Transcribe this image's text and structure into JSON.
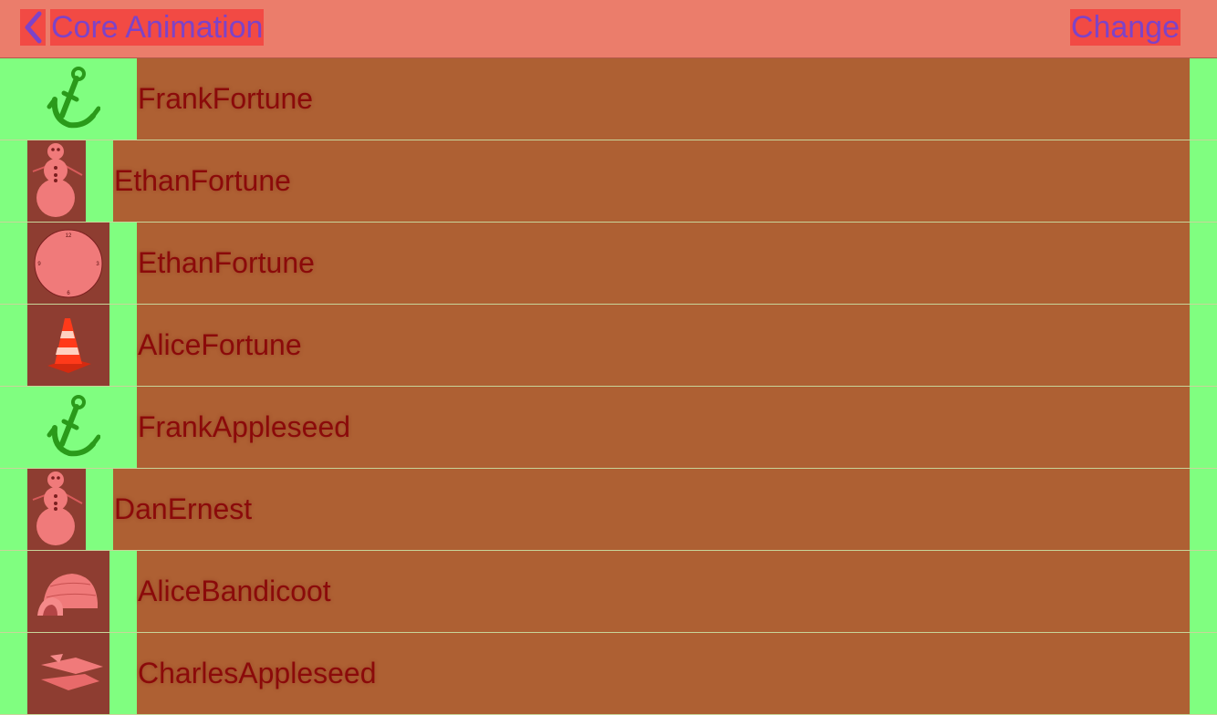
{
  "navbar": {
    "back_label": "Core Animation",
    "change_label": "Change"
  },
  "rows": [
    {
      "name": "FrankFortune",
      "icon": "anchor-icon"
    },
    {
      "name": "EthanFortune",
      "icon": "snowman-icon"
    },
    {
      "name": "EthanFortune",
      "icon": "clock-icon"
    },
    {
      "name": "AliceFortune",
      "icon": "traffic-cone-icon"
    },
    {
      "name": "FrankAppleseed",
      "icon": "anchor-icon"
    },
    {
      "name": "DanErnest",
      "icon": "snowman-icon"
    },
    {
      "name": "AliceBandicoot",
      "icon": "igloo-icon"
    },
    {
      "name": "CharlesAppleseed",
      "icon": "spaceship-icon"
    }
  ],
  "clock": {
    "n12": "12",
    "n3": "3",
    "n6": "6",
    "n9": "9"
  }
}
